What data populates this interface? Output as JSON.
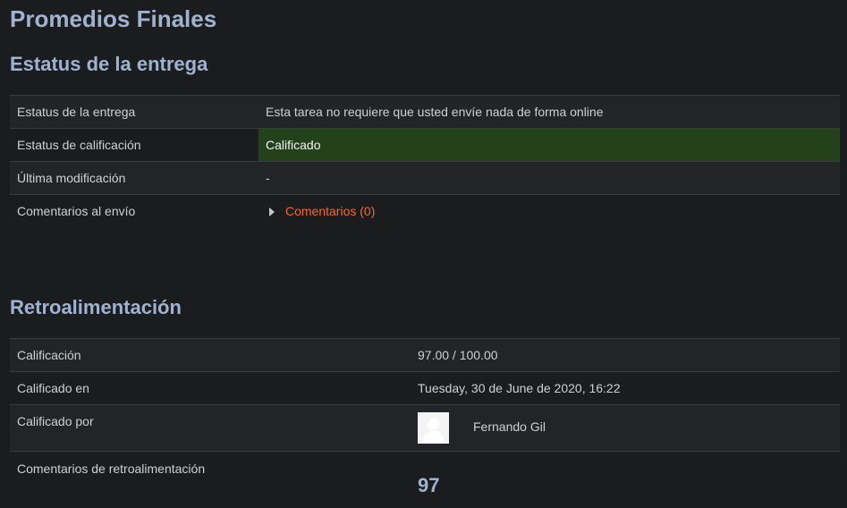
{
  "page": {
    "title": "Promedios Finales"
  },
  "submission": {
    "heading": "Estatus de la entrega",
    "rows": [
      {
        "label": "Estatus de la entrega",
        "value": "Esta tarea no requiere que usted envíe nada de forma online"
      },
      {
        "label": "Estatus de calificación",
        "value": "Calificado"
      },
      {
        "label": "Última modificación",
        "value": "-"
      },
      {
        "label": "Comentarios al envío",
        "value": "Comentarios (0)"
      }
    ]
  },
  "feedback": {
    "heading": "Retroalimentación",
    "rows": [
      {
        "label": "Calificación",
        "value": "97.00 / 100.00"
      },
      {
        "label": "Calificado en",
        "value": "Tuesday, 30 de June de 2020, 16:22"
      },
      {
        "label": "Calificado por",
        "value": "Fernando Gil"
      },
      {
        "label": "Comentarios de retroalimentación",
        "value": "97"
      }
    ]
  },
  "colors": {
    "background": "#1b1c1e",
    "heading": "#9fb3d1",
    "graded_bg": "#23421b",
    "link": "#f26a36"
  },
  "icons": {
    "expand": "triangle-right-icon",
    "avatar": "user-avatar-icon"
  }
}
